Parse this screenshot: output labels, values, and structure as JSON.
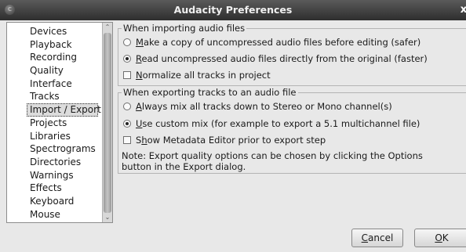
{
  "window": {
    "title": "Audacity Preferences",
    "close_glyph": "x",
    "menu_glyph": "c"
  },
  "sidebar": {
    "items": [
      {
        "label": "Devices"
      },
      {
        "label": "Playback"
      },
      {
        "label": "Recording"
      },
      {
        "label": "Quality"
      },
      {
        "label": "Interface"
      },
      {
        "label": "Tracks"
      },
      {
        "label": "Import / Export",
        "selected": true
      },
      {
        "label": "Projects"
      },
      {
        "label": "Libraries"
      },
      {
        "label": "Spectrograms"
      },
      {
        "label": "Directories"
      },
      {
        "label": "Warnings"
      },
      {
        "label": "Effects"
      },
      {
        "label": "Keyboard"
      },
      {
        "label": "Mouse"
      }
    ],
    "scroll_up_glyph": "⌃",
    "scroll_down_glyph": "⌄"
  },
  "import_group": {
    "legend": "When importing audio files",
    "copy": {
      "first": "M",
      "rest": "ake a copy of uncompressed audio files before editing (safer)",
      "selected": false
    },
    "read": {
      "first": "R",
      "rest": "ead uncompressed audio files directly from the original (faster)",
      "selected": true
    },
    "normalize": {
      "first": "N",
      "rest": "ormalize all tracks in project",
      "checked": false
    }
  },
  "export_group": {
    "legend": "When exporting tracks to an audio file",
    "mix_stereo": {
      "first": "A",
      "rest": "lways mix all tracks down to Stereo or Mono channel(s)",
      "selected": false
    },
    "custom_mix": {
      "first": "U",
      "rest": "se custom mix (for example to export a 5.1 multichannel file)",
      "selected": true
    },
    "metadata": {
      "pre": "S",
      "ul": "h",
      "rest": "ow Metadata Editor prior to export step",
      "checked": false
    },
    "note_line1": "Note: Export quality options can be chosen by clicking the Options",
    "note_line2": "button in the Export dialog."
  },
  "buttons": {
    "cancel": {
      "first": "C",
      "rest": "ancel"
    },
    "ok": {
      "first": "O",
      "rest": "K"
    }
  }
}
